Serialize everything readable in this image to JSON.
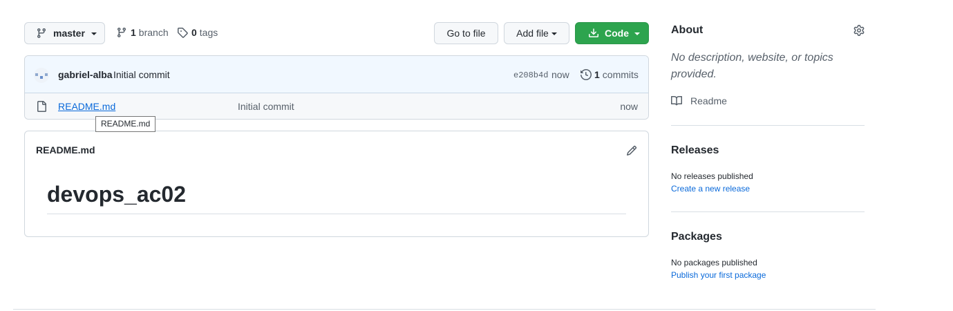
{
  "toolbar": {
    "branch_name": "master",
    "branch_count": "1",
    "branch_label": "branch",
    "tag_count": "0",
    "tag_label": "tags",
    "go_to_file": "Go to file",
    "add_file": "Add file",
    "code": "Code"
  },
  "commit": {
    "author": "gabriel-alba",
    "message": "Initial commit",
    "sha": "e208b4d",
    "time": "now",
    "count": "1",
    "count_label": "commits"
  },
  "files": [
    {
      "name": "README.md",
      "message": "Initial commit",
      "time": "now"
    }
  ],
  "tooltip": "README.md",
  "readme": {
    "filename": "README.md",
    "heading": "devops_ac02"
  },
  "about": {
    "title": "About",
    "description": "No description, website, or topics provided.",
    "readme_link": "Readme"
  },
  "releases": {
    "title": "Releases",
    "empty_text": "No releases published",
    "create_link": "Create a new release"
  },
  "packages": {
    "title": "Packages",
    "empty_text": "No packages published",
    "publish_link": "Publish your first package"
  },
  "colors": {
    "primary_button": "#2da44e",
    "link": "#0969da",
    "commit_bar": "#f1f8ff"
  },
  "icons": [
    "branch-icon",
    "tag-icon",
    "download-icon",
    "history-icon",
    "file-icon",
    "pencil-icon",
    "gear-icon",
    "book-icon"
  ]
}
